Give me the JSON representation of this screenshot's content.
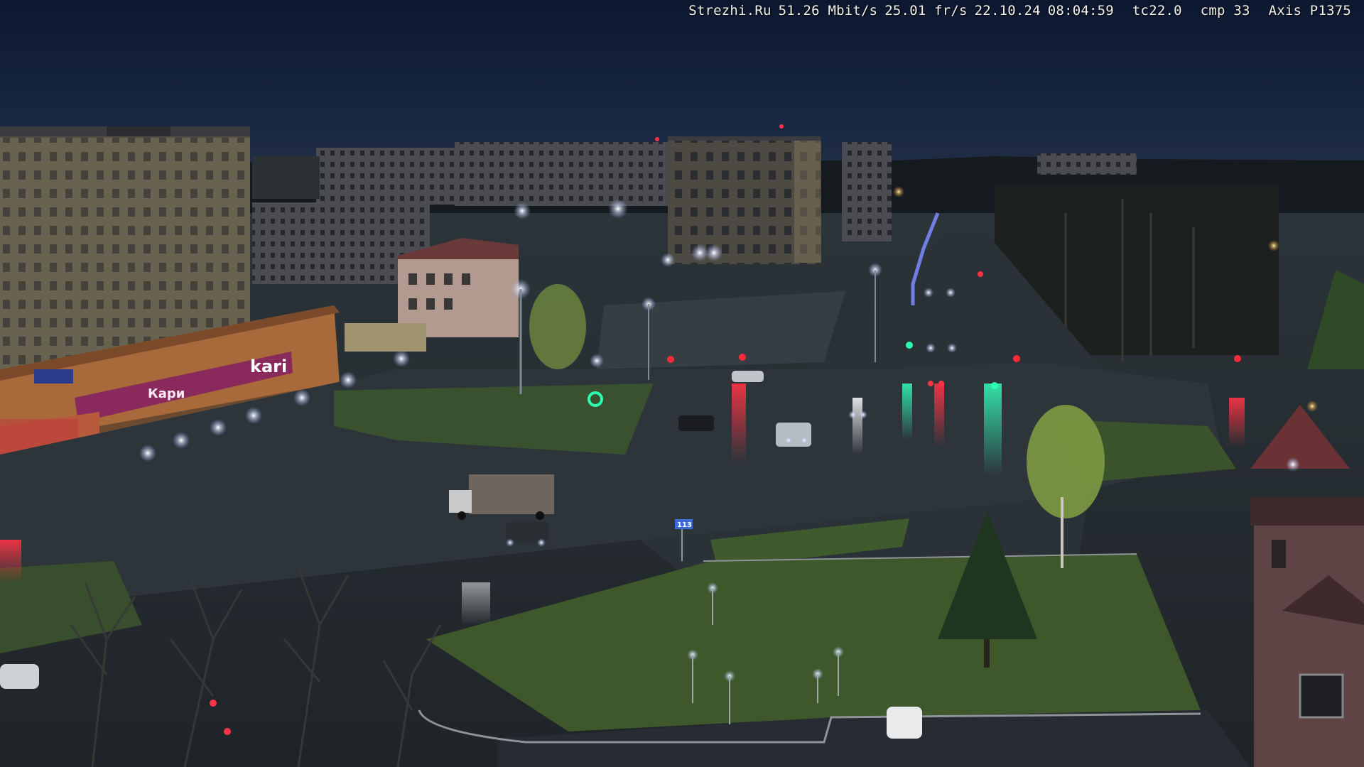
{
  "overlay": {
    "site": "Strezhi.Ru",
    "bitrate": "51.26 Mbit/s",
    "framerate": "25.01 fr/s",
    "date": "22.10.24",
    "time": "08:04:59",
    "tc": "tc22.0",
    "cmp": "cmp 33",
    "camera": "Axis P1375"
  },
  "signs": {
    "store_brand": "kari",
    "store_sign_left": "Кари",
    "bus_stop_number": "113"
  },
  "palette": {
    "sky_top": "#0e1a33",
    "sky_horizon": "#1c2a44",
    "asphalt": "#2a3036",
    "grass": "#3f5a2c",
    "street_light": "#f4f7ff",
    "signal_red": "#ff2a3a",
    "signal_green": "#2bffb0",
    "kari_magenta": "#8a2a5c"
  }
}
